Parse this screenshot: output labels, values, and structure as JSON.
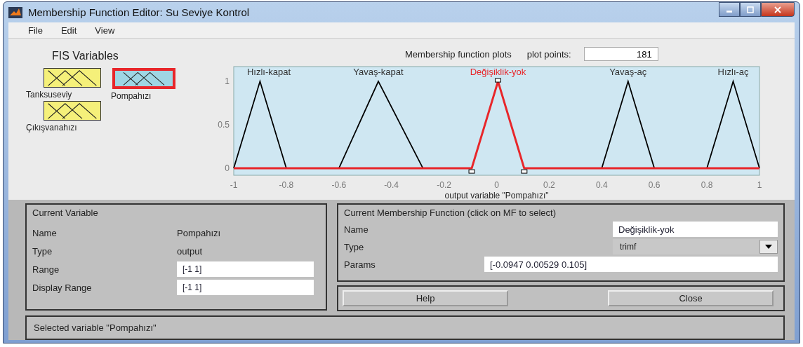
{
  "window": {
    "title": "Membership Function Editor: Su Seviye Kontrol"
  },
  "menu": [
    "File",
    "Edit",
    "View"
  ],
  "fis_variables": {
    "title": "FIS Variables",
    "items": [
      {
        "label": "Tanksuseviy",
        "kind": "input",
        "selected": false
      },
      {
        "label": "Pompahızı",
        "kind": "output",
        "selected": true
      },
      {
        "label": "Çıkışvanahızı",
        "kind": "input",
        "selected": false
      }
    ]
  },
  "plot_points": {
    "label": "plot points:",
    "value": "181"
  },
  "chart_data": {
    "type": "line",
    "title": "Membership function plots",
    "xlabel": "output variable \"Pompahızı\"",
    "x": [
      -1,
      -0.9,
      -0.8,
      -0.6,
      -0.45,
      -0.28,
      -0.0947,
      0.00529,
      0.105,
      0.4,
      0.5,
      0.6,
      0.8,
      0.9,
      1
    ],
    "series": [
      {
        "name": "Hızlı-kapat",
        "color": "#000000",
        "values": [
          0,
          1,
          0,
          null,
          null,
          null,
          null,
          null,
          null,
          null,
          null,
          null,
          null,
          null,
          null
        ]
      },
      {
        "name": "Yavaş-kapat",
        "color": "#000000",
        "values": [
          null,
          null,
          null,
          0,
          1,
          0,
          null,
          null,
          null,
          null,
          null,
          null,
          null,
          null,
          null
        ]
      },
      {
        "name": "Değişiklik-yok",
        "color": "#e8262a",
        "values": [
          0,
          0,
          0,
          0,
          0,
          0,
          0,
          1,
          0,
          0,
          0,
          0,
          0,
          0,
          0
        ]
      },
      {
        "name": "Yavaş-aç",
        "color": "#000000",
        "values": [
          null,
          null,
          null,
          null,
          null,
          null,
          null,
          null,
          null,
          0,
          1,
          0,
          null,
          null,
          null
        ]
      },
      {
        "name": "Hızlı-aç",
        "color": "#000000",
        "values": [
          null,
          null,
          null,
          null,
          null,
          null,
          null,
          null,
          null,
          null,
          null,
          null,
          0,
          1,
          0
        ]
      }
    ],
    "xlim": [
      -1,
      1
    ],
    "ylim": [
      -0.08,
      1.17
    ],
    "xticks": [
      -1,
      -0.8,
      -0.6,
      -0.4,
      -0.2,
      0,
      0.2,
      0.4,
      0.6,
      0.8,
      1
    ],
    "yticks": [
      0,
      0.5,
      1
    ]
  },
  "current_variable": {
    "title": "Current Variable",
    "name_label": "Name",
    "name": "Pompahızı",
    "type_label": "Type",
    "type": "output",
    "range_label": "Range",
    "range": "[-1 1]",
    "display_range_label": "Display Range",
    "display_range": "[-1 1]"
  },
  "current_mf": {
    "title": "Current Membership Function (click on MF to select)",
    "name_label": "Name",
    "name": "Değişiklik-yok",
    "type_label": "Type",
    "type": "trimf",
    "params_label": "Params",
    "params": "[-0.0947 0.00529 0.105]"
  },
  "buttons": [
    "Help",
    "Close"
  ],
  "status_bar": "Selected variable \"Pompahızı\""
}
